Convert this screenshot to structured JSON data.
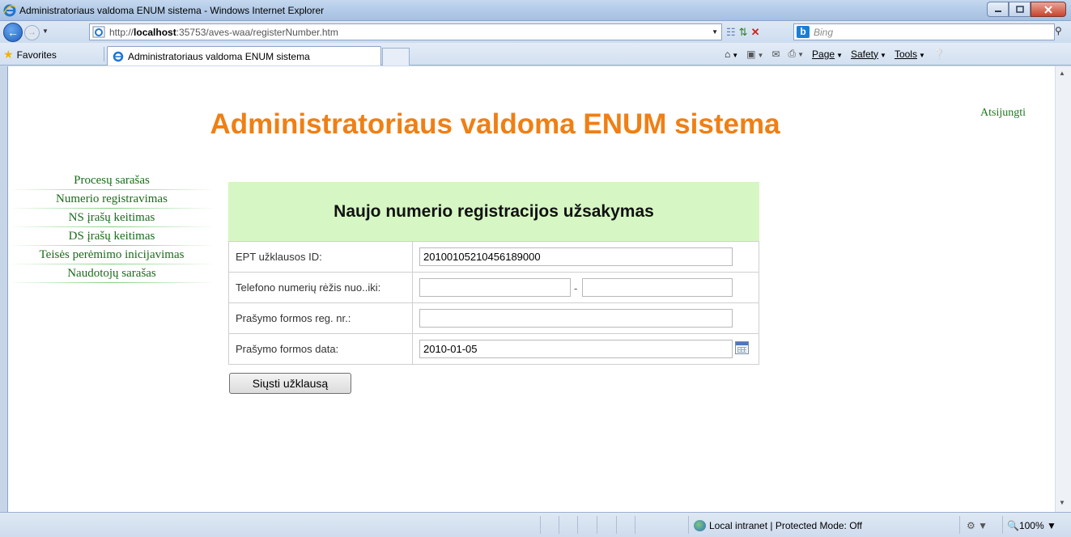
{
  "window": {
    "title": "Administratoriaus valdoma ENUM sistema - Windows Internet Explorer"
  },
  "addressbar": {
    "url_prefix": "http://",
    "url_host": "localhost",
    "url_rest": ":35753/aves-waa/registerNumber.htm",
    "search_placeholder": "Bing"
  },
  "favbar": {
    "favorites_label": "Favorites",
    "tab_label": "Administratoriaus valdoma ENUM sistema",
    "page_label": "Page",
    "safety_label": "Safety",
    "tools_label": "Tools"
  },
  "page": {
    "title": "Administratoriaus valdoma ENUM sistema",
    "logout": "Atsijungti",
    "menu": [
      {
        "label": "Procesų sarašas"
      },
      {
        "label": "Numerio registravimas"
      },
      {
        "label": "NS įrašų keitimas"
      },
      {
        "label": "DS įrašų keitimas"
      },
      {
        "label": "Teisės perėmimo inicijavimas"
      },
      {
        "label": "Naudotojų sarašas"
      }
    ],
    "form": {
      "heading": "Naujo numerio registracijos užsakymas",
      "rows": [
        {
          "label": "EPT užklausos ID:",
          "value": "20100105210456189000"
        },
        {
          "label": "Telefono numerių rėžis nuo..iki:",
          "from": "",
          "to": "",
          "separator": "-"
        },
        {
          "label": "Prašymo formos reg. nr.:",
          "value": ""
        },
        {
          "label": "Prašymo formos data:",
          "value": "2010-01-05"
        }
      ],
      "submit": "Siųsti užklausą"
    }
  },
  "statusbar": {
    "zone": "Local intranet | Protected Mode: Off",
    "zoom": "100%"
  }
}
